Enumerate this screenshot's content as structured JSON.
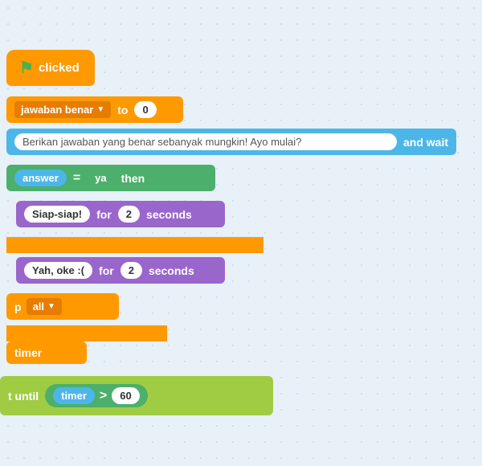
{
  "blocks": {
    "hat_block": {
      "label": "clicked",
      "flag": "⚑"
    },
    "set_block": {
      "variable": "jawaban benar",
      "to_label": "to",
      "value": "0"
    },
    "ask_block": {
      "question": "Berikan jawaban yang benar sebanyak mungkin! Ayo mulai?",
      "wait_label": "and wait"
    },
    "if_block": {
      "answer_label": "answer",
      "equals": "=",
      "value": "ya",
      "then_label": "then"
    },
    "say_siap": {
      "text": "Siap-siap!",
      "for_label": "for",
      "duration": "2",
      "unit": "seconds"
    },
    "say_yah": {
      "text": "Yah, oke :(",
      "for_label": "for",
      "duration": "2",
      "unit": "seconds"
    },
    "stop_block": {
      "prefix": "p",
      "option": "all"
    },
    "reset_timer": {
      "label": "timer"
    },
    "wait_until": {
      "prefix": "t until",
      "timer_label": "timer",
      "operator": ">",
      "value": "60"
    }
  }
}
